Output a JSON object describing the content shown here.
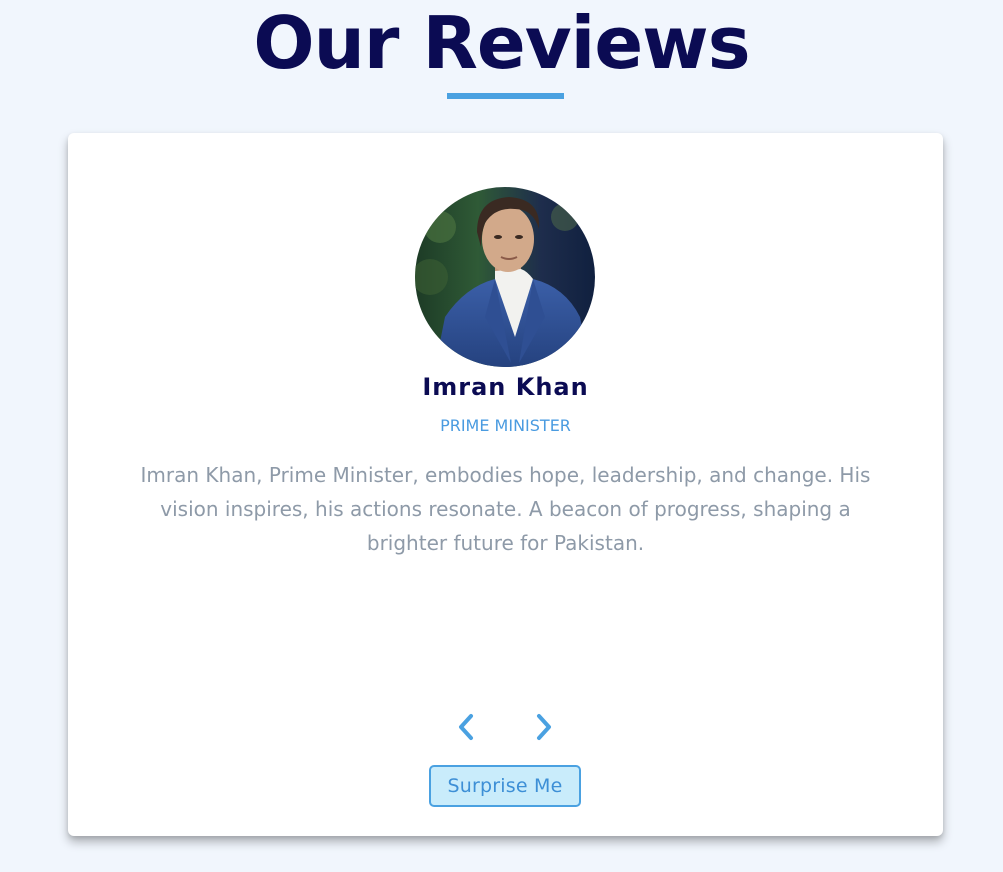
{
  "section": {
    "title": "Our Reviews"
  },
  "review": {
    "name": "Imran Khan",
    "job": "PRIME MINISTER",
    "text": "Imran Khan, Prime Minister, embodies hope, leadership, and change. His vision inspires, his actions resonate. A beacon of progress, shaping a brighter future for Pakistan.",
    "image_alt": "Imran Khan"
  },
  "controls": {
    "prev_icon": "chevron-left-icon",
    "next_icon": "chevron-right-icon",
    "surprise_label": "Surprise Me"
  },
  "colors": {
    "background": "#f1f6fd",
    "title": "#0b0b53",
    "accent": "#4aa1e1",
    "text": "#8e9aa8",
    "button_bg": "#c9ecfb"
  }
}
